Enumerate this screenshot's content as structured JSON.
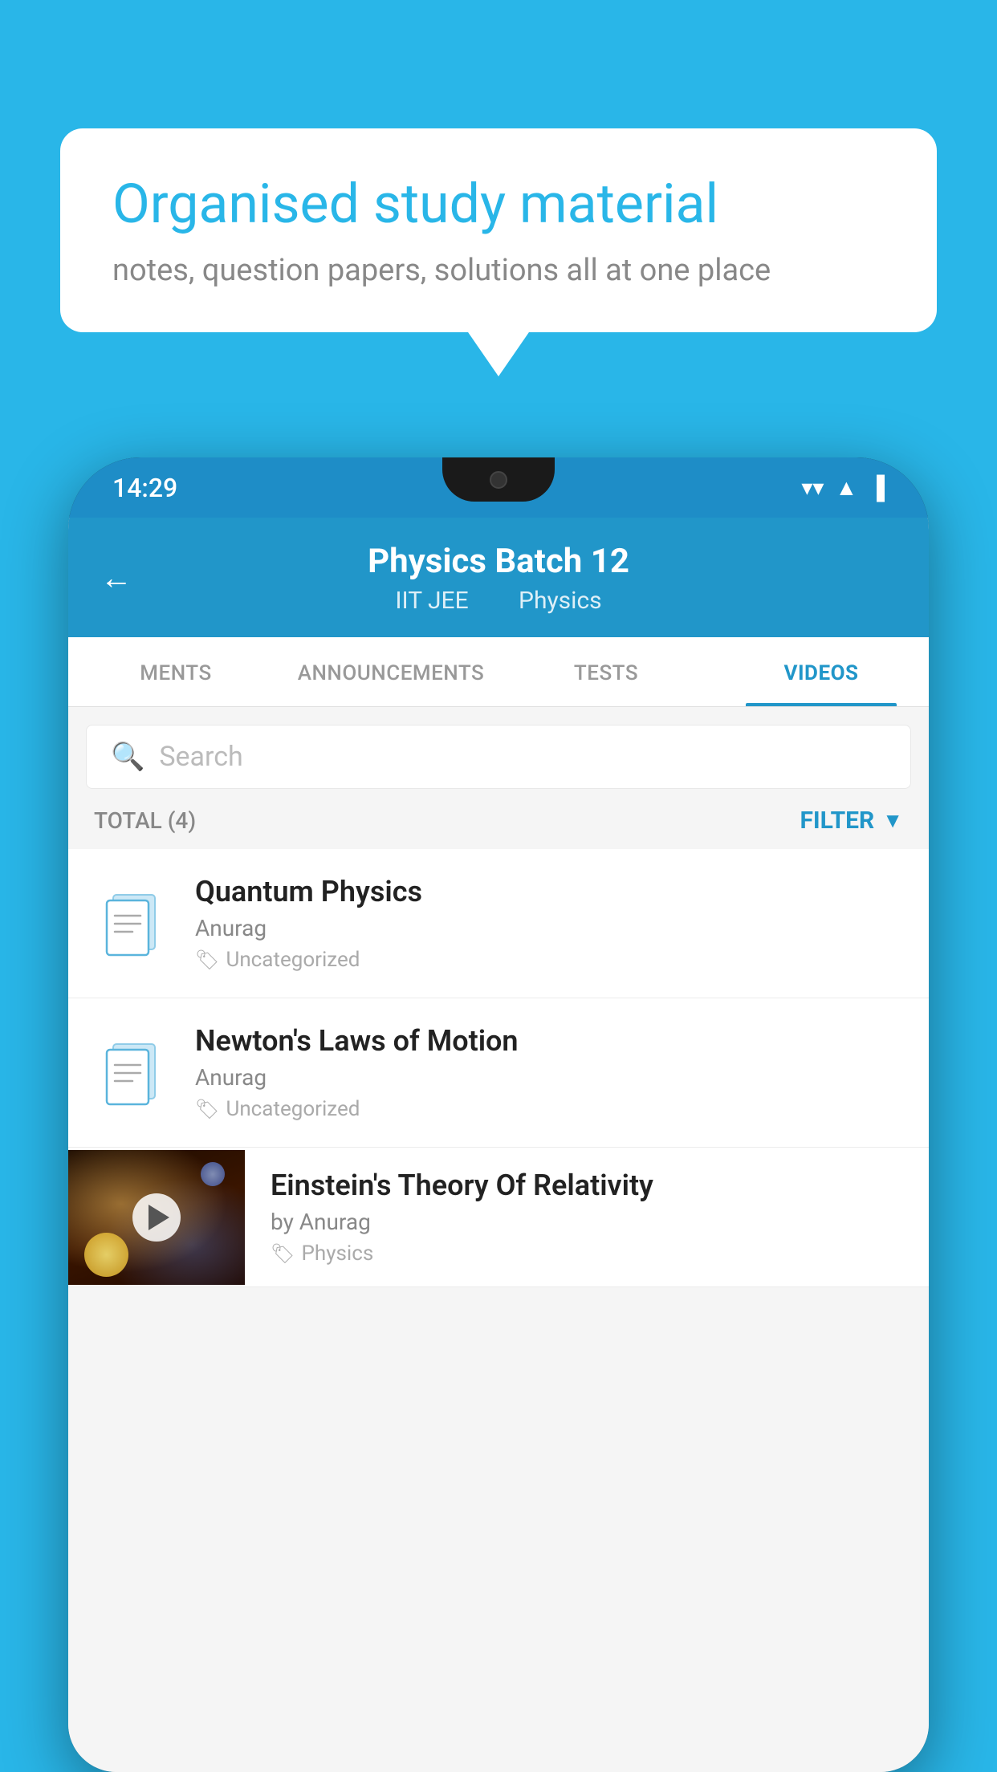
{
  "background": {
    "color": "#29b6e8"
  },
  "speech_bubble": {
    "title": "Organised study material",
    "subtitle": "notes, question papers, solutions all at one place"
  },
  "phone": {
    "status_bar": {
      "time": "14:29"
    },
    "header": {
      "title": "Physics Batch 12",
      "subtitle_part1": "IIT JEE",
      "subtitle_part2": "Physics",
      "back_label": "←"
    },
    "tabs": [
      {
        "label": "MENTS",
        "active": false
      },
      {
        "label": "ANNOUNCEMENTS",
        "active": false
      },
      {
        "label": "TESTS",
        "active": false
      },
      {
        "label": "VIDEOS",
        "active": true
      }
    ],
    "search": {
      "placeholder": "Search"
    },
    "filter_row": {
      "total_label": "TOTAL (4)",
      "filter_label": "FILTER"
    },
    "list_items": [
      {
        "title": "Quantum Physics",
        "author": "Anurag",
        "tag": "Uncategorized",
        "has_thumbnail": false
      },
      {
        "title": "Newton's Laws of Motion",
        "author": "Anurag",
        "tag": "Uncategorized",
        "has_thumbnail": false
      },
      {
        "title": "Einstein's Theory Of Relativity",
        "author": "by Anurag",
        "tag": "Physics",
        "has_thumbnail": true
      }
    ]
  }
}
